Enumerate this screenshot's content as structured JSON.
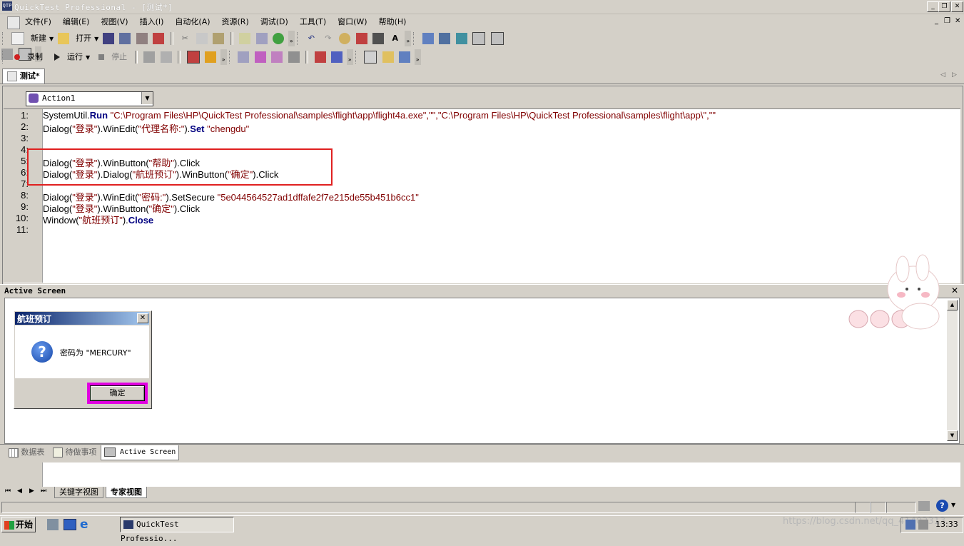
{
  "window": {
    "title": "QuickTest Professional - [测试*]",
    "app_icon": "QTP",
    "minimize": "_",
    "restore": "❐",
    "close": "✕"
  },
  "menu": [
    "文件(F)",
    "编辑(E)",
    "视图(V)",
    "插入(I)",
    "自动化(A)",
    "资源(R)",
    "调试(D)",
    "工具(T)",
    "窗口(W)",
    "帮助(H)"
  ],
  "toolbar1": {
    "new_label": "新建",
    "open_label": "打开"
  },
  "toolbar2": {
    "record_label": "录制",
    "run_label": "运行",
    "stop_label": "停止"
  },
  "doc_tab": {
    "label": "测试*"
  },
  "action_selector": {
    "value": "Action1"
  },
  "code_lines": [
    {
      "n": "1:"
    },
    {
      "n": "2:"
    },
    {
      "n": "3:"
    },
    {
      "n": "4:"
    },
    {
      "n": "5:"
    },
    {
      "n": "6:"
    },
    {
      "n": "7:"
    },
    {
      "n": "8:"
    },
    {
      "n": "9:"
    },
    {
      "n": "10:"
    },
    {
      "n": "11:"
    }
  ],
  "code": {
    "l1_a": "SystemUtil.",
    "l1_kw": "Run",
    "l1_b": " ",
    "l1_str": "\"C:\\Program Files\\HP\\QuickTest Professional\\samples\\flight\\app\\flight4a.exe\",\"\",\"C:\\Program Files\\HP\\QuickTest Professional\\samples\\flight\\app\\\",\"\"",
    "l2_a": "Dialog(",
    "l2_s1": "\"登录\"",
    "l2_b": ").WinEdit(",
    "l2_s2": "\"代理名称:\"",
    "l2_c": ").",
    "l2_kw": "Set",
    "l2_d": " ",
    "l2_s3": "\"chengdu\"",
    "l5_a": "Dialog(",
    "l5_s1": "\"登录\"",
    "l5_b": ").WinButton(",
    "l5_s2": "\"帮助\"",
    "l5_c": ").Click",
    "l6_a": "Dialog(",
    "l6_s1": "\"登录\"",
    "l6_b": ").Dialog(",
    "l6_s2": "\"航班预订\"",
    "l6_c": ").WinButton(",
    "l6_s3": "\"确定\"",
    "l6_d": ").Click",
    "l8_a": "Dialog(",
    "l8_s1": "\"登录\"",
    "l8_b": ").WinEdit(",
    "l8_s2": "\"密码:\"",
    "l8_c": ").SetSecure ",
    "l8_s3": "\"5e044564527ad1dffafe2f7e215de55b451b6cc1\"",
    "l9_a": "Dialog(",
    "l9_s1": "\"登录\"",
    "l9_b": ").WinButton(",
    "l9_s2": "\"确定\"",
    "l9_c": ").Click",
    "l10_a": "Window(",
    "l10_s1": "\"航班预订\"",
    "l10_b": ").",
    "l10_kw": "Close"
  },
  "active_screen": {
    "header": "Active Screen",
    "dialog_title": "航班预订",
    "dialog_close": "✕",
    "dialog_message": "密码为 \"MERCURY\"",
    "ok_button": "确定"
  },
  "bottom_tabs": [
    "数据表",
    "待做事项",
    "Active Screen"
  ],
  "view_tabs": [
    "关键字视图",
    "专家视图"
  ],
  "taskbar": {
    "start": "开始",
    "task": "QuickTest Professio...",
    "clock": "13:33",
    "watermark": "https://blog.csdn.net/qq_41402313"
  },
  "colors": {
    "keyword": "#000080",
    "string": "#800000",
    "highlight_red": "#e02020",
    "highlight_magenta": "#e000e0"
  }
}
